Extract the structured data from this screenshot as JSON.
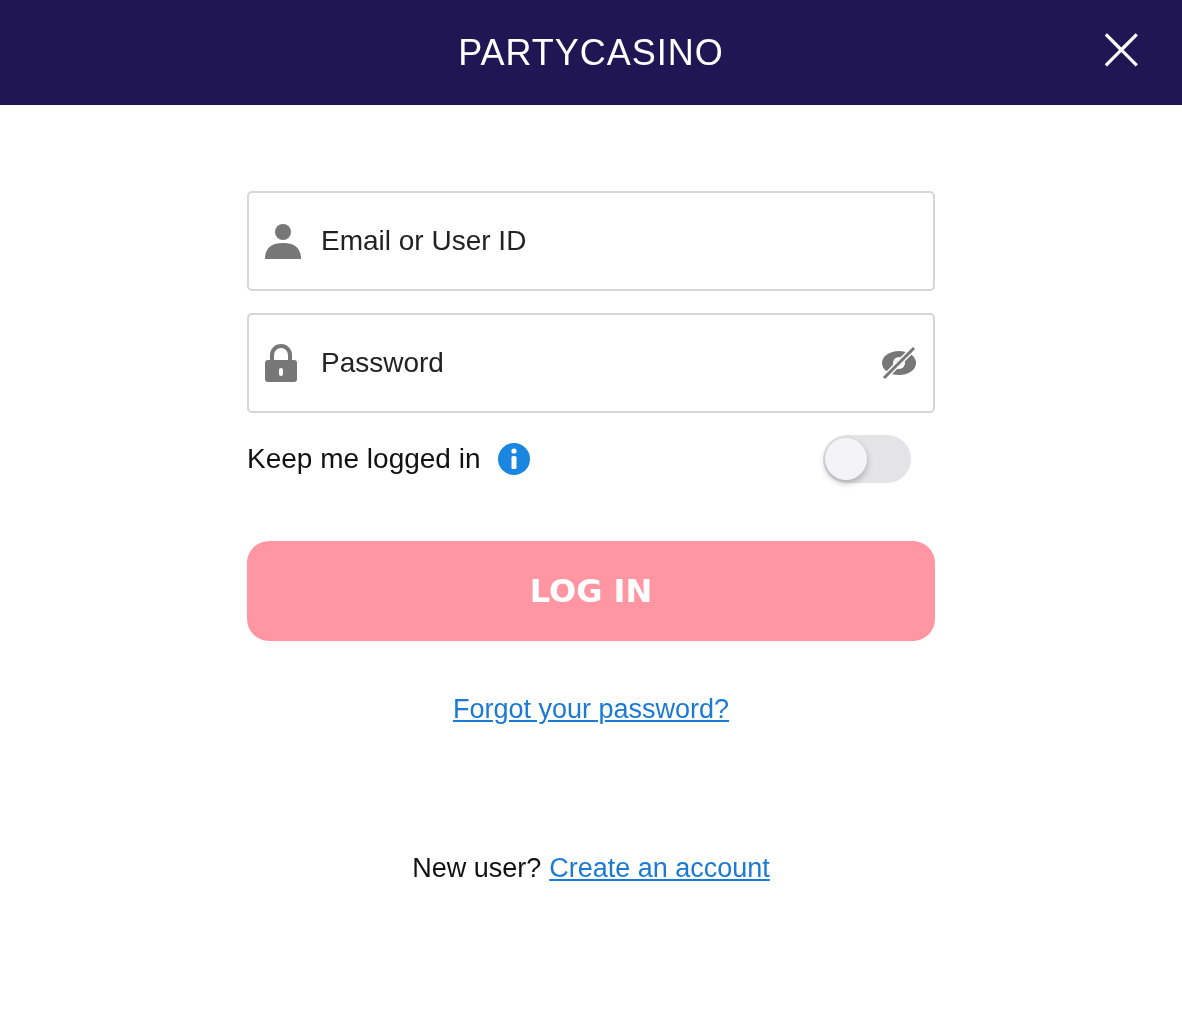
{
  "header": {
    "logo": "PARTYCASINO",
    "close": "×"
  },
  "fields": [
    {
      "kind": "user",
      "placeholder": "Email or User ID"
    },
    {
      "kind": "password",
      "placeholder": "Password"
    }
  ],
  "keep_logged_in": {
    "label": "Keep me logged in",
    "on": false
  },
  "login_button": {
    "label": "LOG IN",
    "disabled": true
  },
  "forgot_link": "Forgot your password?",
  "signup": {
    "prompt": "New user?",
    "link": "Create an account"
  }
}
